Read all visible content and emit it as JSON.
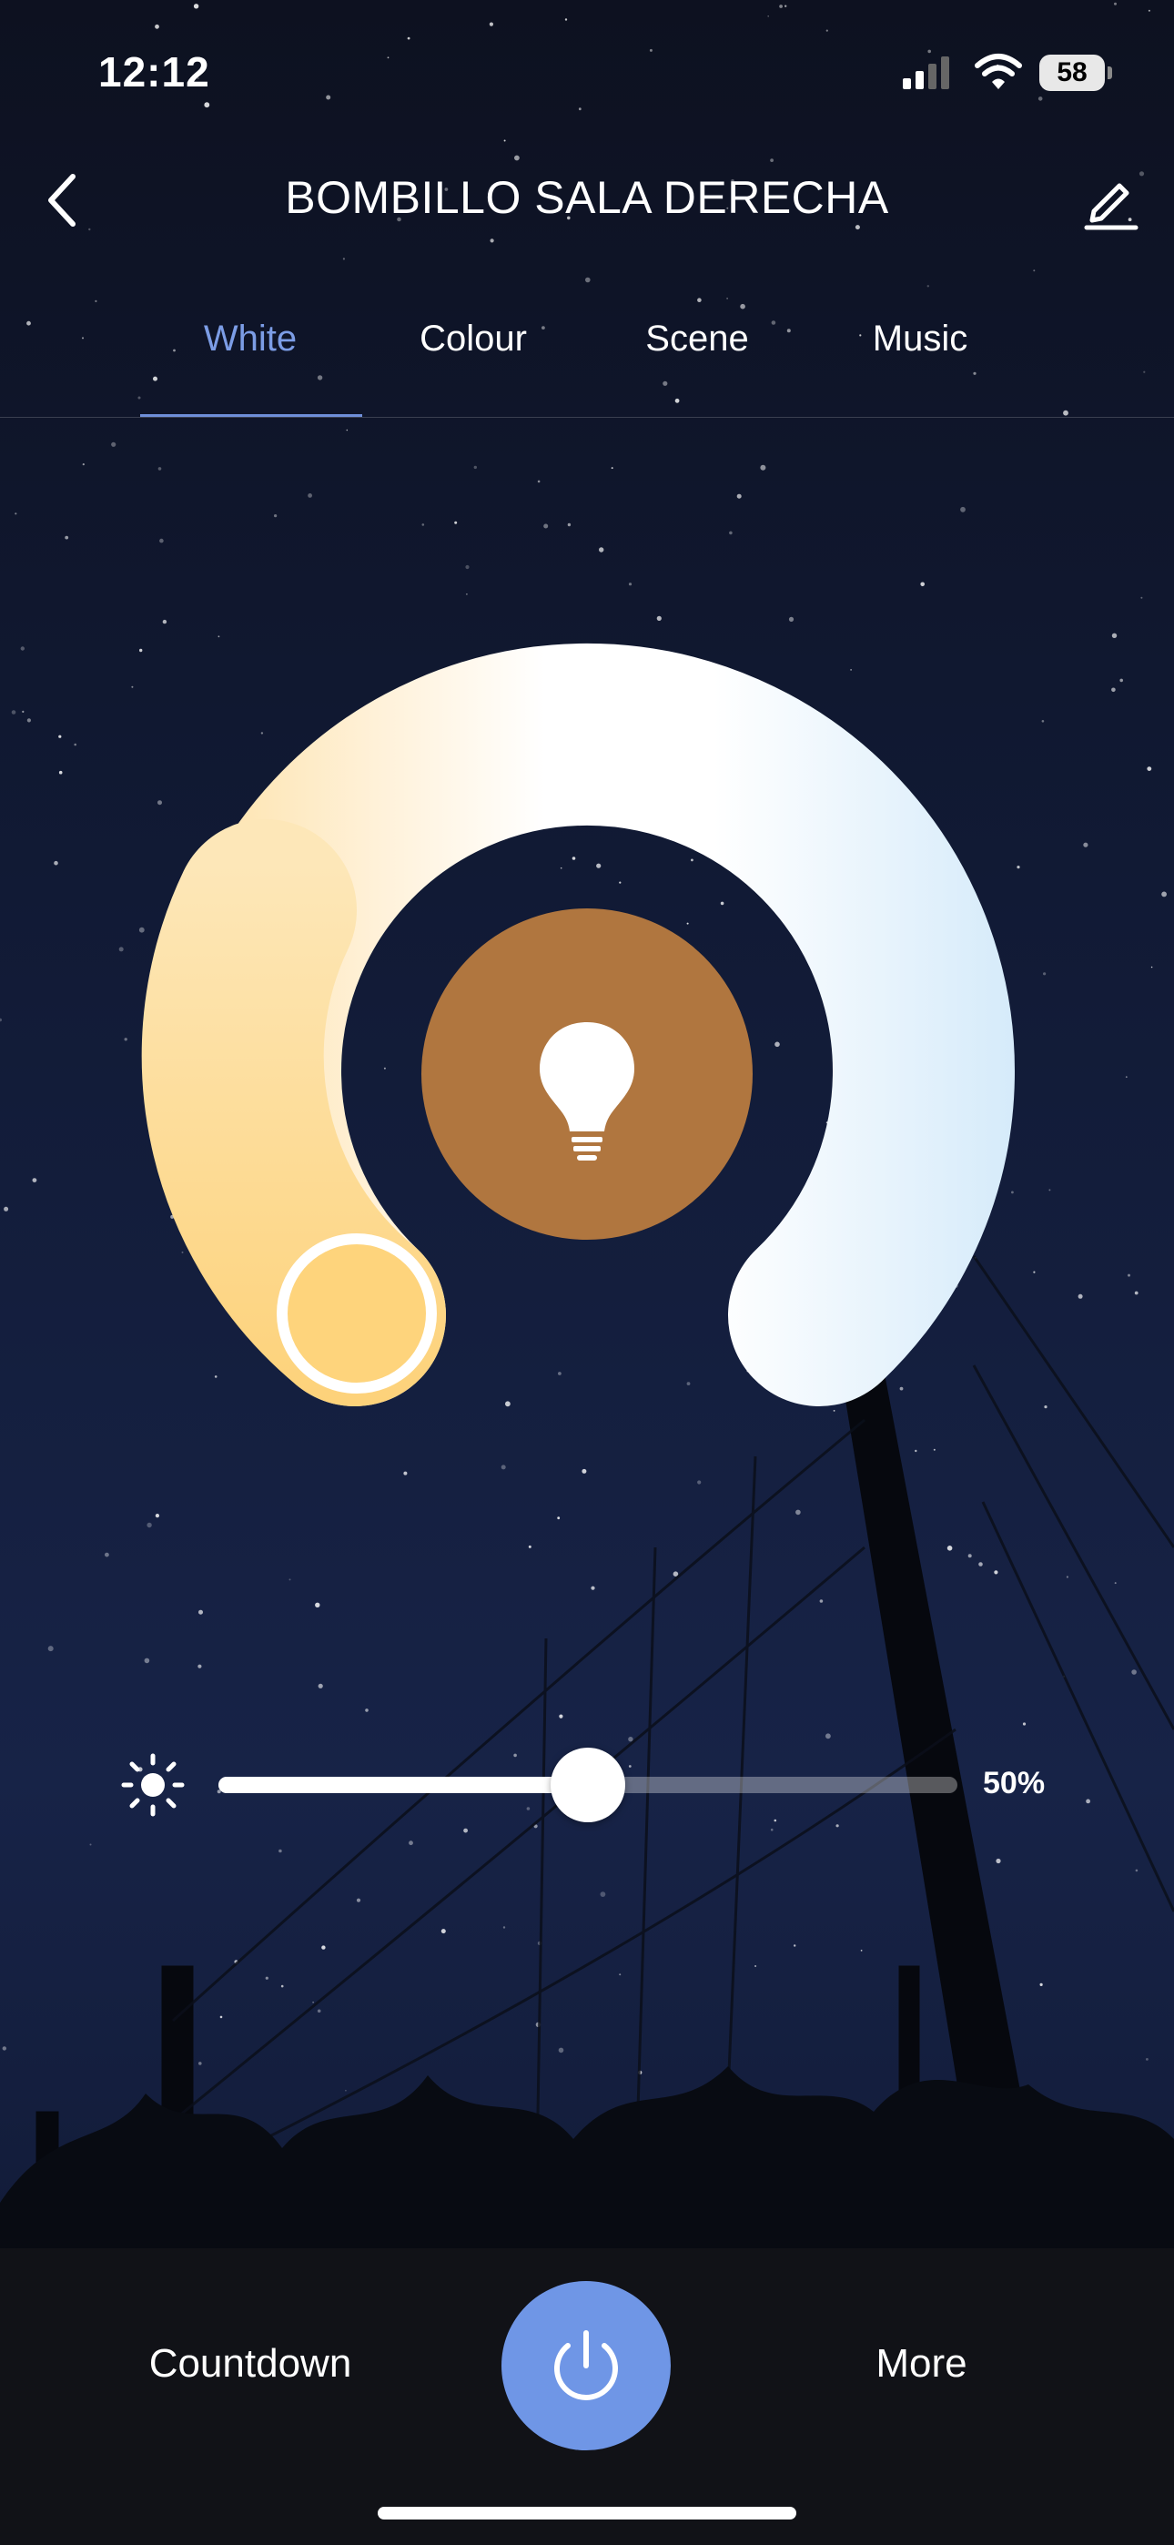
{
  "status_bar": {
    "time": "12:12",
    "battery": "58"
  },
  "header": {
    "title": "BOMBILLO SALA DERECHA"
  },
  "tabs": [
    {
      "label": "White",
      "active": true
    },
    {
      "label": "Colour",
      "active": false
    },
    {
      "label": "Scene",
      "active": false
    },
    {
      "label": "Music",
      "active": false
    }
  ],
  "temperature_dial": {
    "warm_color": "#FDD27A",
    "cool_color": "#D6EBFA",
    "center_color": "#B0763F",
    "icon": "bulb-icon"
  },
  "brightness": {
    "label": "50%",
    "value": 0.5,
    "icon": "sun-icon"
  },
  "bottom": {
    "countdown_label": "Countdown",
    "more_label": "More",
    "power_color": "#6F96E6"
  },
  "colors": {
    "accent": "#7C9DE6"
  }
}
